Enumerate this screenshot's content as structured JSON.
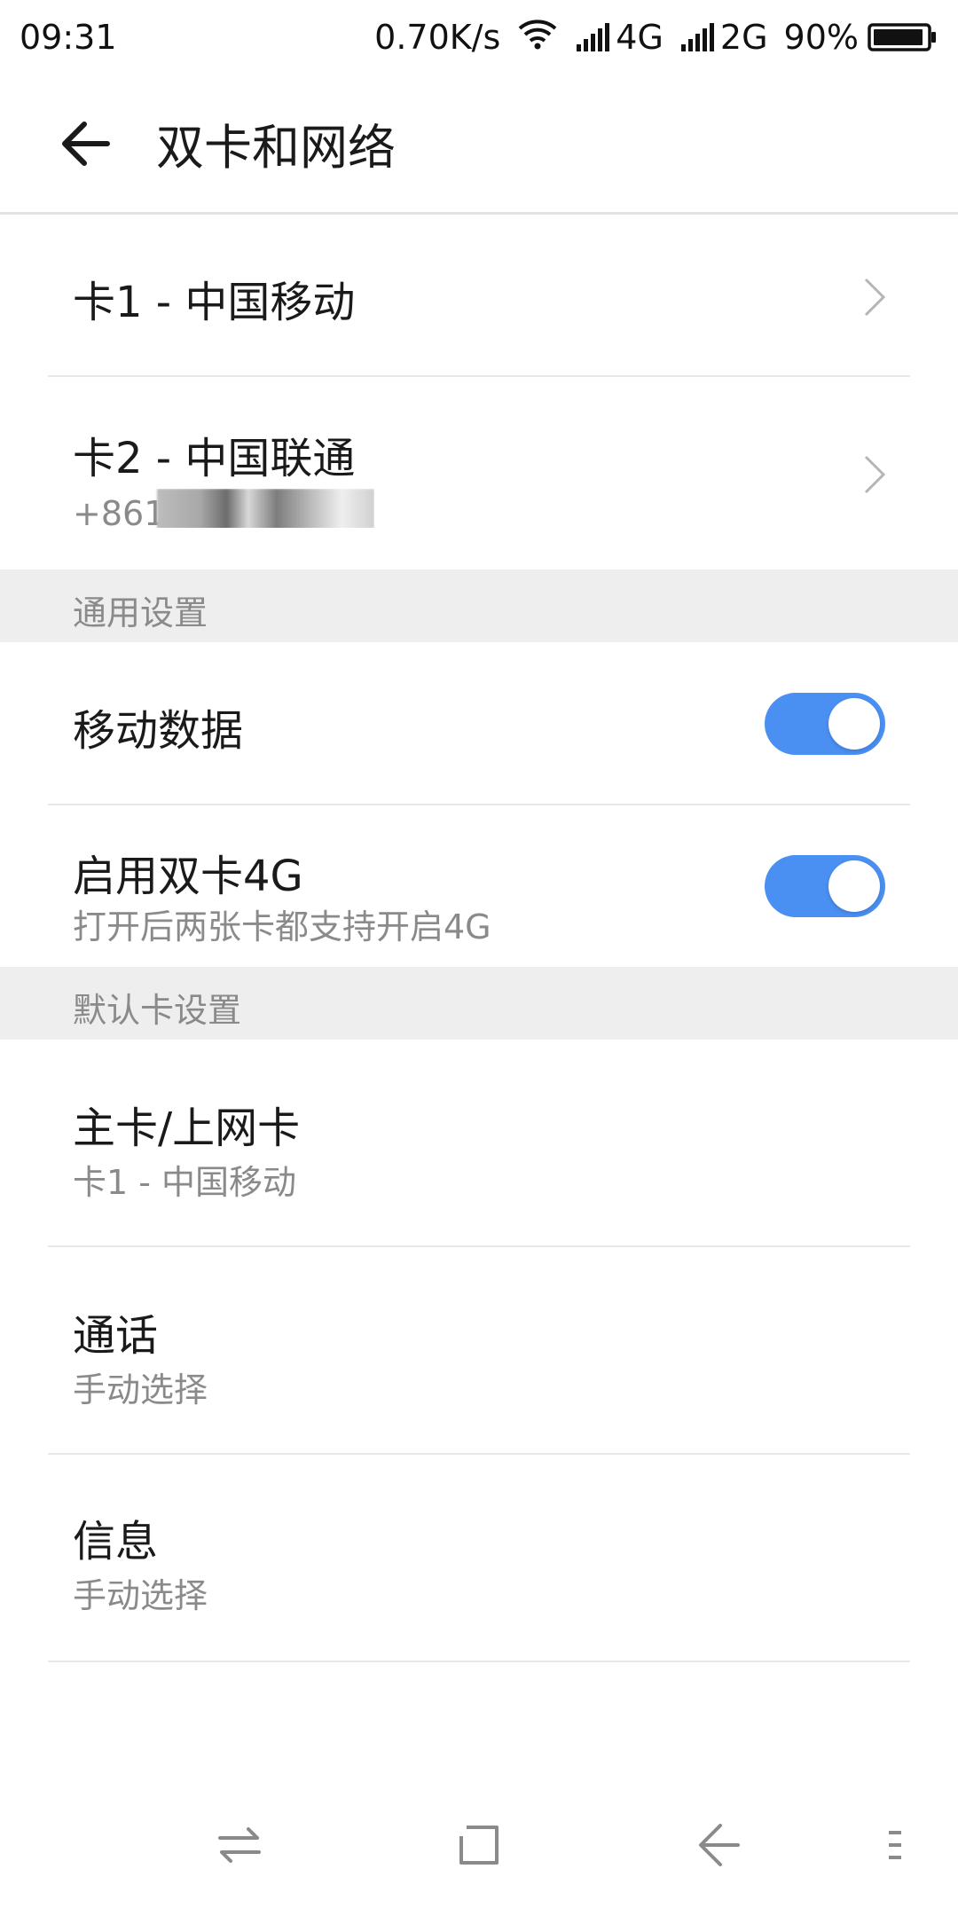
{
  "status_bar": {
    "time": "09:31",
    "speed": "0.70K/s",
    "sim1_network": "4G",
    "sim2_network": "2G",
    "battery": "90%",
    "icons": [
      "wifi-icon",
      "signal-icon",
      "signal-icon",
      "battery-icon"
    ]
  },
  "header": {
    "title": "双卡和网络",
    "back_icon": "arrow-left-icon"
  },
  "sim_cards": [
    {
      "label": "卡1 - 中国移动"
    },
    {
      "label": "卡2 - 中国联通",
      "number": "+86131"
    }
  ],
  "sections": {
    "general": "通用设置",
    "default_card": "默认卡设置"
  },
  "general_settings": {
    "mobile_data": {
      "label": "移动数据",
      "enabled": true
    },
    "dual_4g": {
      "label": "启用双卡4G",
      "description": "打开后两张卡都支持开启4G",
      "enabled": true
    }
  },
  "default_card_settings": {
    "primary": {
      "label": "主卡/上网卡",
      "value": "卡1 - 中国移动"
    },
    "call": {
      "label": "通话",
      "value": "手动选择"
    },
    "message": {
      "label": "信息",
      "value": "手动选择"
    }
  },
  "nav_bar": {
    "icons": [
      "switch-icon",
      "home-square-icon",
      "back-icon",
      "menu-icon"
    ]
  },
  "colors": {
    "accent": "#4a8ff2",
    "section_bg": "#eeeeee",
    "secondary_text": "#8a8a8a"
  }
}
